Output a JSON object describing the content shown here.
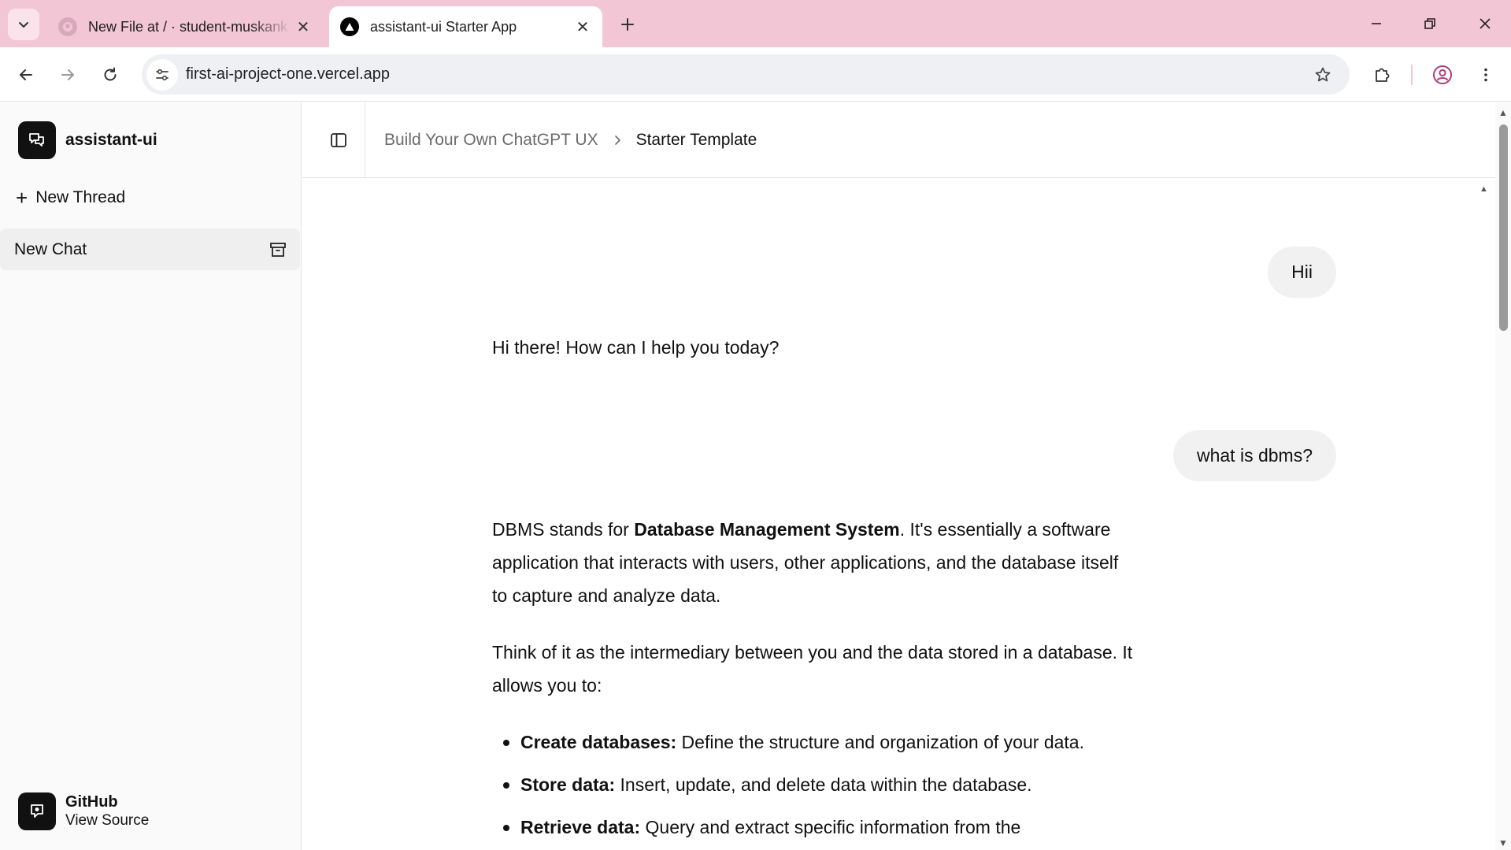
{
  "browser": {
    "tabs": [
      {
        "title": "New File at / · student-muskank",
        "active": false,
        "icon": "github-icon"
      },
      {
        "title": "assistant-ui Starter App",
        "active": true,
        "icon": "vercel-triangle-icon"
      }
    ],
    "url": "first-ai-project-one.vercel.app",
    "colors": {
      "tabbar": "#f3c6d6",
      "omnibox": "#eef0f3",
      "profile": "#b03a7c"
    }
  },
  "sidebar": {
    "brand": "assistant-ui",
    "new_thread_label": "New Thread",
    "threads": [
      {
        "label": "New Chat"
      }
    ],
    "footer": {
      "title": "GitHub",
      "subtitle": "View Source"
    }
  },
  "header": {
    "breadcrumb": [
      "Build Your Own ChatGPT UX",
      "Starter Template"
    ]
  },
  "messages": {
    "user_1": "Hii",
    "assistant_1": "Hi there! How can I help you today?",
    "user_2": "what is dbms?",
    "assistant_2": {
      "p1_pre": "DBMS stands for ",
      "p1_bold": "Database Management System",
      "p1_post": ". It's essentially a software application that interacts with users, other applications, and the database itself to capture and analyze data.",
      "p2": "Think of it as the intermediary between you and the data stored in a database. It allows you to:",
      "bullets": [
        {
          "term": "Create databases:",
          "text": " Define the structure and organization of your data."
        },
        {
          "term": "Store data:",
          "text": " Insert, update, and delete data within the database."
        },
        {
          "term": "Retrieve data:",
          "text": " Query and extract specific information from the"
        }
      ]
    }
  }
}
